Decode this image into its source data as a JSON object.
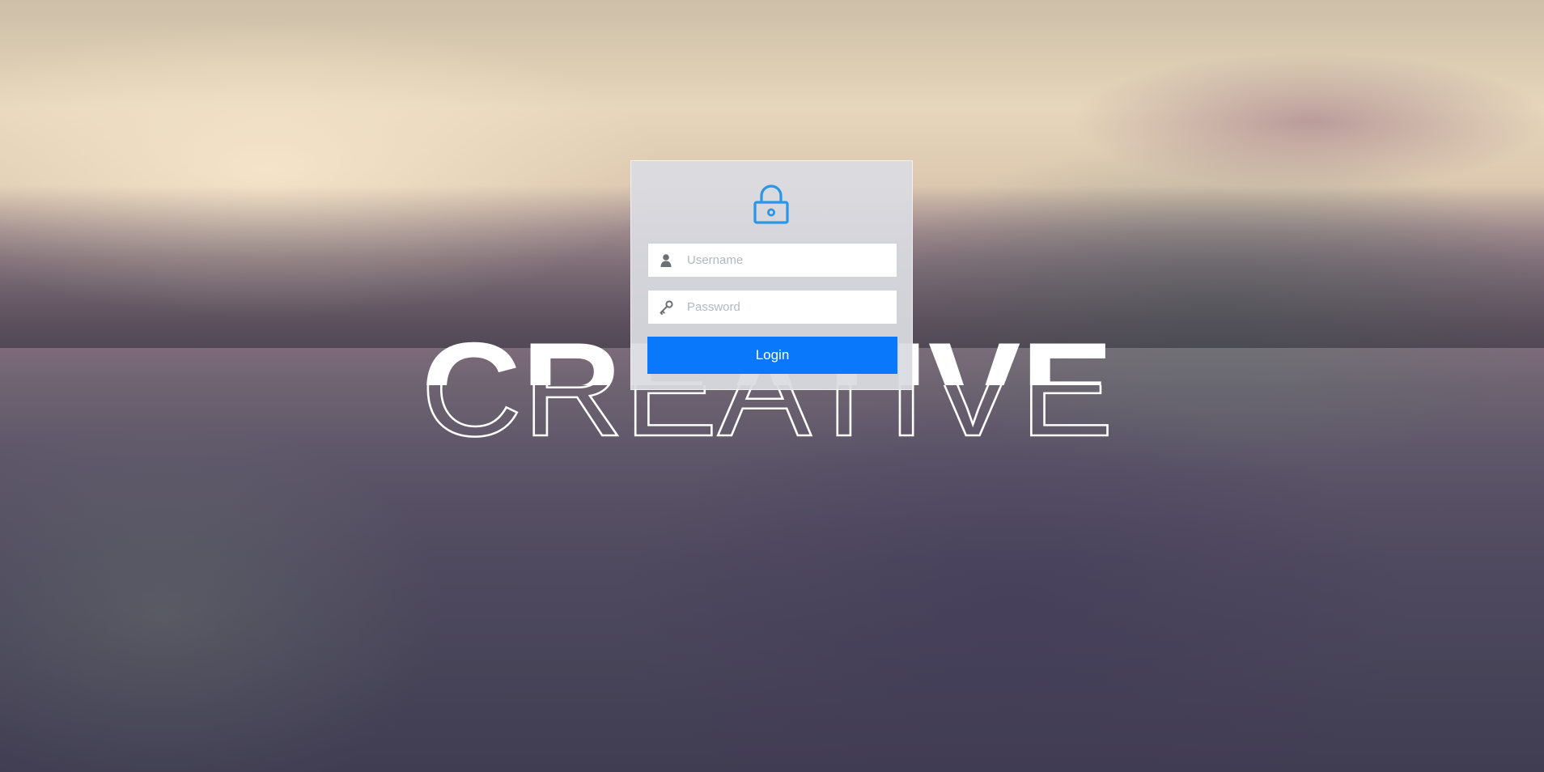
{
  "background": {
    "description_colors": {
      "sky": "#e6d6bb",
      "forest": "#554f64"
    }
  },
  "brand": {
    "wordmark_top": "CREATIVE",
    "wordmark_bottom": "CREATIVE"
  },
  "login": {
    "icon": "lock-icon",
    "username": {
      "icon": "user-icon",
      "placeholder": "Username",
      "value": ""
    },
    "password": {
      "icon": "key-icon",
      "placeholder": "Password",
      "value": ""
    },
    "submit_label": "Login",
    "accent_color": "#0a78fa"
  }
}
